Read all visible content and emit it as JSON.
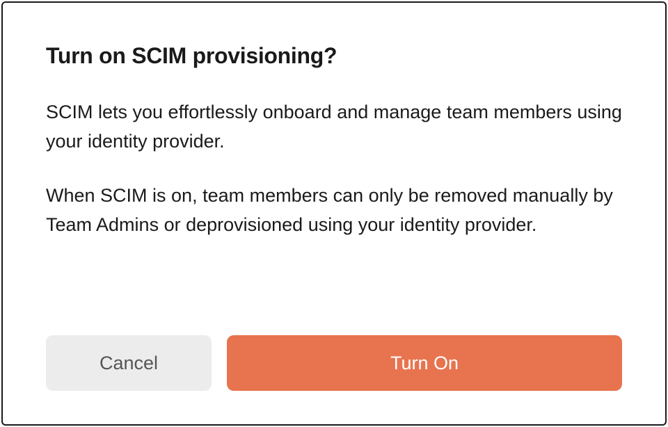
{
  "dialog": {
    "title": "Turn on SCIM provisioning?",
    "paragraphs": [
      "SCIM lets you effortlessly onboard and manage team members using your identity provider.",
      "When SCIM is on, team members can only be removed manually by Team Admins or deprovisioned using your identity provider."
    ],
    "actions": {
      "cancel_label": "Cancel",
      "confirm_label": "Turn On"
    }
  },
  "colors": {
    "primary": "#e8744f",
    "secondary_bg": "#ececec",
    "text": "#1a1a1a",
    "muted_text": "#555555"
  }
}
